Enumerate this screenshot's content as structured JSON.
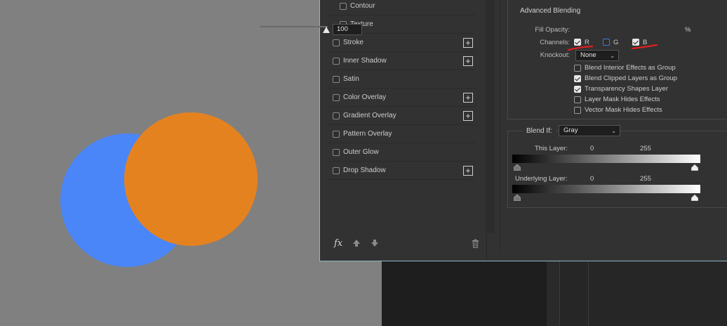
{
  "styles": {
    "items": [
      {
        "label": "Contour",
        "checked": false,
        "sub": true,
        "plus": false
      },
      {
        "label": "Texture",
        "checked": false,
        "sub": true,
        "plus": false
      },
      {
        "label": "Stroke",
        "checked": false,
        "sub": false,
        "plus": true
      },
      {
        "label": "Inner Shadow",
        "checked": false,
        "sub": false,
        "plus": true
      },
      {
        "label": "Satin",
        "checked": false,
        "sub": false,
        "plus": false
      },
      {
        "label": "Color Overlay",
        "checked": false,
        "sub": false,
        "plus": true
      },
      {
        "label": "Gradient Overlay",
        "checked": false,
        "sub": false,
        "plus": true
      },
      {
        "label": "Pattern Overlay",
        "checked": false,
        "sub": false,
        "plus": false
      },
      {
        "label": "Outer Glow",
        "checked": false,
        "sub": false,
        "plus": false
      },
      {
        "label": "Drop Shadow",
        "checked": false,
        "sub": false,
        "plus": true
      }
    ],
    "plus_glyph": "+",
    "fx_label": "fx"
  },
  "advanced": {
    "title": "Advanced Blending",
    "fill_opacity_label": "Fill Opacity:",
    "fill_opacity_value": "100",
    "fill_opacity_unit": "%",
    "channels_label": "Channels:",
    "channels": [
      {
        "label": "R",
        "checked": true
      },
      {
        "label": "G",
        "checked": false
      },
      {
        "label": "B",
        "checked": true
      }
    ],
    "knockout_label": "Knockout:",
    "knockout_value": "None",
    "options": [
      {
        "label": "Blend Interior Effects as Group",
        "checked": false
      },
      {
        "label": "Blend Clipped Layers as Group",
        "checked": true
      },
      {
        "label": "Transparency Shapes Layer",
        "checked": true
      },
      {
        "label": "Layer Mask Hides Effects",
        "checked": false
      },
      {
        "label": "Vector Mask Hides Effects",
        "checked": false
      }
    ]
  },
  "blend_if": {
    "label": "Blend If:",
    "value": "Gray",
    "this_layer_label": "This Layer:",
    "this_layer_min": "0",
    "this_layer_max": "255",
    "underlying_label": "Underlying Layer:",
    "underlying_min": "0",
    "underlying_max": "255"
  },
  "colors": {
    "canvas": "#808080",
    "blue_circle": "#4a86f7",
    "orange_circle": "#e58220",
    "annotation": "#e0201e"
  }
}
